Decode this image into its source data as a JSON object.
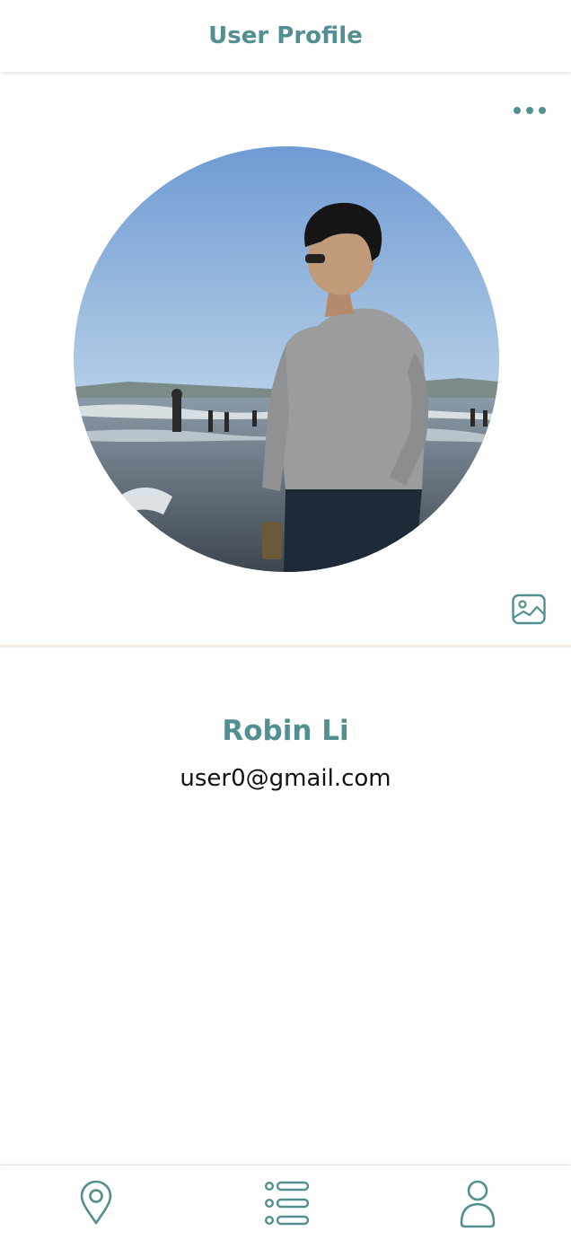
{
  "header": {
    "title": "User Profile"
  },
  "profile": {
    "photo": "beach-profile-photo",
    "name": "Robin Li",
    "email": "user0@gmail.com"
  },
  "actions": {
    "more_icon": "more-horizontal-icon",
    "change_photo_icon": "image-icon"
  },
  "tabbar": {
    "items": [
      {
        "icon": "map-pin-icon"
      },
      {
        "icon": "list-icon"
      },
      {
        "icon": "user-icon"
      }
    ]
  },
  "colors": {
    "accent": "#528f90",
    "divider": "#f6ebe6",
    "text": "#111111"
  }
}
